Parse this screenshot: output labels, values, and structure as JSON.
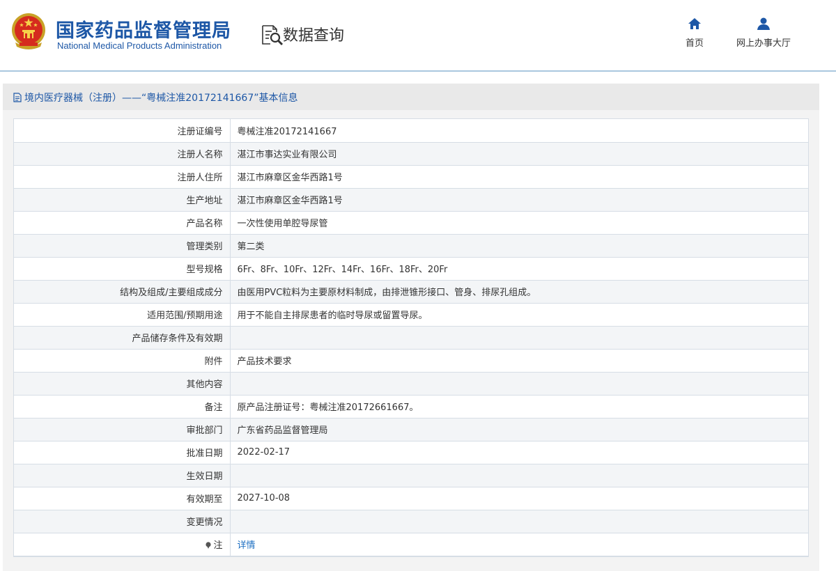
{
  "header": {
    "logo_cn": "国家药品监督管理局",
    "logo_en": "National Medical Products Administration",
    "query_title": "数据查询",
    "nav": [
      {
        "label": "首页",
        "icon": "home-icon"
      },
      {
        "label": "网上办事大厅",
        "icon": "user-icon"
      }
    ]
  },
  "colors": {
    "brand_blue": "#1d57a6",
    "link_blue": "#1d6fc2",
    "header_rule": "#a9c7df"
  },
  "panel": {
    "title": "境内医疗器械（注册）——“粤械注准20172141667”基本信息"
  },
  "details": [
    {
      "label": "注册证编号",
      "value": "粤械注准20172141667"
    },
    {
      "label": "注册人名称",
      "value": "湛江市事达实业有限公司"
    },
    {
      "label": "注册人住所",
      "value": "湛江市麻章区金华西路1号"
    },
    {
      "label": "生产地址",
      "value": "湛江市麻章区金华西路1号"
    },
    {
      "label": "产品名称",
      "value": "一次性使用单腔导尿管"
    },
    {
      "label": "管理类别",
      "value": "第二类"
    },
    {
      "label": "型号规格",
      "value": "6Fr、8Fr、10Fr、12Fr、14Fr、16Fr、18Fr、20Fr"
    },
    {
      "label": "结构及组成/主要组成成分",
      "value": "由医用PVC粒料为主要原材料制成，由排泄锥形接口、管身、排尿孔组成。"
    },
    {
      "label": "适用范围/预期用途",
      "value": "用于不能自主排尿患者的临时导尿或留置导尿。"
    },
    {
      "label": "产品储存条件及有效期",
      "value": ""
    },
    {
      "label": "附件",
      "value": "产品技术要求"
    },
    {
      "label": "其他内容",
      "value": ""
    },
    {
      "label": "备注",
      "value": "原产品注册证号：粤械注准20172661667。"
    },
    {
      "label": "审批部门",
      "value": "广东省药品监督管理局"
    },
    {
      "label": "批准日期",
      "value": "2022-02-17"
    },
    {
      "label": "生效日期",
      "value": ""
    },
    {
      "label": "有效期至",
      "value": "2027-10-08"
    },
    {
      "label": "变更情况",
      "value": ""
    }
  ],
  "note_row": {
    "label": "注",
    "link": "详情",
    "icon": "pin-icon"
  }
}
